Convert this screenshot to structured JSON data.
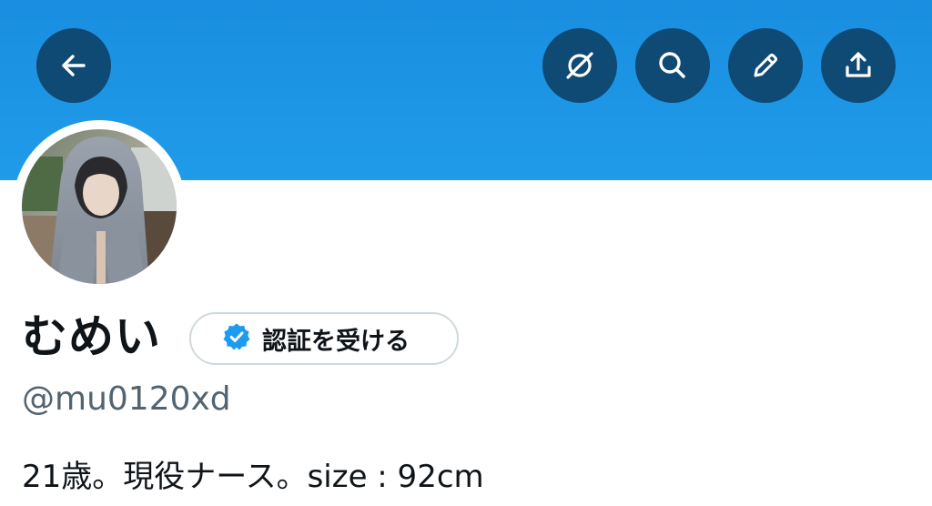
{
  "header": {
    "back_icon": "arrow-left-icon",
    "actions": [
      {
        "icon": "mute-off-icon"
      },
      {
        "icon": "search-icon"
      },
      {
        "icon": "pencil-edit-icon"
      },
      {
        "icon": "share-upload-icon"
      }
    ],
    "banner_color": "#1d96e6",
    "button_color": "#0e4a73"
  },
  "profile": {
    "display_name": "むめい",
    "verify_button_label": "認証を受ける",
    "verified_badge_icon": "verified-badge-icon",
    "handle": "@mu0120xd",
    "bio": "21歳。現役ナース。size : 92cm",
    "accent_color": "#1d9bf0"
  }
}
